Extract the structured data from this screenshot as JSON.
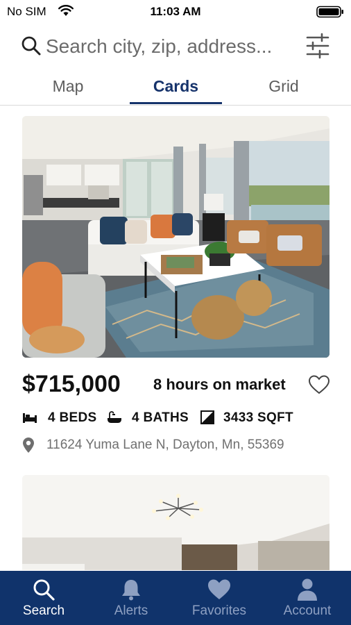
{
  "status_bar": {
    "carrier": "No SIM",
    "time": "11:03 AM"
  },
  "search": {
    "placeholder": "Search city, zip, address..."
  },
  "view_tabs": [
    {
      "label": "Map",
      "active": false
    },
    {
      "label": "Cards",
      "active": true
    },
    {
      "label": "Grid",
      "active": false
    }
  ],
  "listings": [
    {
      "price": "$715,000",
      "time_on_market": "8 hours on market",
      "beds": "4 BEDS",
      "baths": "4 BATHS",
      "sqft": "3433 SQFT",
      "address": "11624 Yuma Lane N, Dayton, Mn, 55369",
      "favorited": false
    }
  ],
  "bottom_nav": [
    {
      "label": "Search",
      "icon": "search-icon",
      "active": true
    },
    {
      "label": "Alerts",
      "icon": "bell-icon",
      "active": false
    },
    {
      "label": "Favorites",
      "icon": "heart-icon",
      "active": false
    },
    {
      "label": "Account",
      "icon": "person-icon",
      "active": false
    }
  ],
  "colors": {
    "brand_navy": "#16336b",
    "tab_bar_bg": "#10336b",
    "inactive_nav": "#8ea0c2"
  }
}
